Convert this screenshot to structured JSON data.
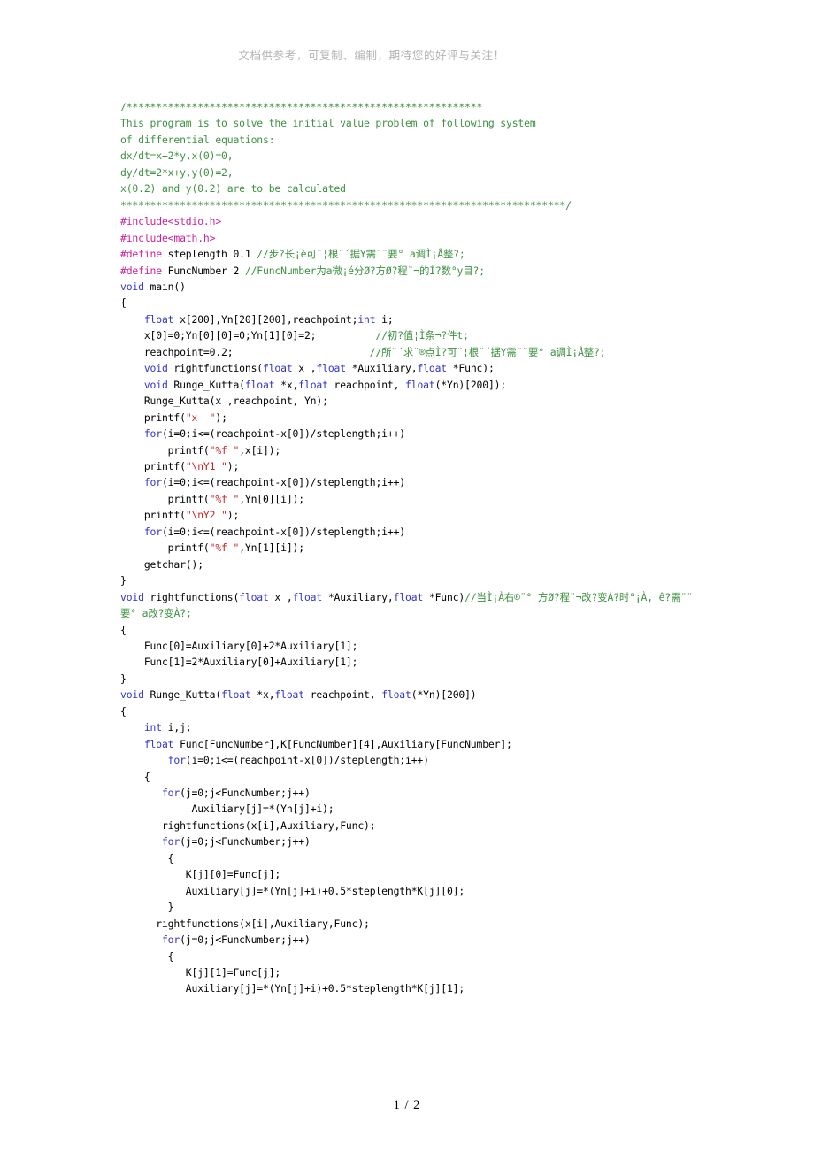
{
  "document": {
    "header_note": "文档供参考，可复制、编制，期待您的好评与关注！",
    "footer_page": "1 / 2",
    "page_current": "1",
    "page_total": "2"
  },
  "colors": {
    "comment": "#3d9140",
    "preprocessor": "#cc2299",
    "keyword": "#3333cc",
    "string": "#cc2222",
    "plain": "#000000",
    "header_note": "#b4b4b4",
    "background": "#ffffff"
  },
  "code": {
    "language": "C",
    "lines": [
      {
        "id": 1,
        "segments": [
          {
            "t": "comment",
            "v": "/************************************************************"
          }
        ]
      },
      {
        "id": 2,
        "segments": [
          {
            "t": "comment",
            "v": "This program is to solve the initial value problem of following system"
          }
        ]
      },
      {
        "id": 3,
        "segments": [
          {
            "t": "comment",
            "v": "of differential equations:"
          }
        ]
      },
      {
        "id": 4,
        "segments": [
          {
            "t": "comment",
            "v": "dx/dt=x+2*y,x(0)=0,"
          }
        ]
      },
      {
        "id": 5,
        "segments": [
          {
            "t": "comment",
            "v": "dy/dt=2*x+y,y(0)=2,"
          }
        ]
      },
      {
        "id": 6,
        "segments": [
          {
            "t": "comment",
            "v": "x(0.2) and y(0.2) are to be calculated"
          }
        ]
      },
      {
        "id": 7,
        "segments": [
          {
            "t": "comment",
            "v": "***************************************************************************/"
          }
        ]
      },
      {
        "id": 8,
        "segments": [
          {
            "t": "pre",
            "v": "#include"
          },
          {
            "t": "pre",
            "v": "<stdio.h>"
          }
        ]
      },
      {
        "id": 9,
        "segments": [
          {
            "t": "pre",
            "v": "#include"
          },
          {
            "t": "pre",
            "v": "<math.h>"
          }
        ]
      },
      {
        "id": 10,
        "segments": [
          {
            "t": "pre",
            "v": "#define"
          },
          {
            "t": "plain",
            "v": " steplength 0.1 "
          },
          {
            "t": "comment",
            "v": "//步?长¡è可¨¦根¨´据Y需¨¨要° a调Ì¡Å整?;"
          }
        ]
      },
      {
        "id": 11,
        "segments": [
          {
            "t": "pre",
            "v": "#define"
          },
          {
            "t": "plain",
            "v": " FuncNumber 2 "
          },
          {
            "t": "comment",
            "v": "//FuncNumber为a微¡é分Ø?方Ø?程¨¬的Ì?数°y目?;"
          }
        ]
      },
      {
        "id": 12,
        "segments": [
          {
            "t": "key",
            "v": "void"
          },
          {
            "t": "plain",
            "v": " main()"
          }
        ]
      },
      {
        "id": 13,
        "segments": [
          {
            "t": "plain",
            "v": "{"
          }
        ]
      },
      {
        "id": 14,
        "segments": [
          {
            "t": "plain",
            "v": "    "
          },
          {
            "t": "key",
            "v": "float"
          },
          {
            "t": "plain",
            "v": " x[200],Yn[20][200],reachpoint;"
          },
          {
            "t": "key",
            "v": "int"
          },
          {
            "t": "plain",
            "v": " i;"
          }
        ]
      },
      {
        "id": 15,
        "segments": [
          {
            "t": "plain",
            "v": "    x[0]=0;Yn[0][0]=0;Yn[1][0]=2;          "
          },
          {
            "t": "comment",
            "v": "//初?值¦Ì条¬?件t;"
          }
        ]
      },
      {
        "id": 16,
        "segments": [
          {
            "t": "plain",
            "v": "    reachpoint=0.2;                       "
          },
          {
            "t": "comment",
            "v": "//所¨´求¨®点Ì?可¨¦根¨´据Y需¨¨要° a调Ì¡Å整?;"
          }
        ]
      },
      {
        "id": 17,
        "segments": [
          {
            "t": "plain",
            "v": "    "
          },
          {
            "t": "key",
            "v": "void"
          },
          {
            "t": "plain",
            "v": " rightfunctions("
          },
          {
            "t": "key",
            "v": "float"
          },
          {
            "t": "plain",
            "v": " x ,"
          },
          {
            "t": "key",
            "v": "float"
          },
          {
            "t": "plain",
            "v": " *Auxiliary,"
          },
          {
            "t": "key",
            "v": "float"
          },
          {
            "t": "plain",
            "v": " *Func);"
          }
        ]
      },
      {
        "id": 18,
        "segments": [
          {
            "t": "plain",
            "v": "    "
          },
          {
            "t": "key",
            "v": "void"
          },
          {
            "t": "plain",
            "v": " Runge_Kutta("
          },
          {
            "t": "key",
            "v": "float"
          },
          {
            "t": "plain",
            "v": " *x,"
          },
          {
            "t": "key",
            "v": "float"
          },
          {
            "t": "plain",
            "v": " reachpoint, "
          },
          {
            "t": "key",
            "v": "float"
          },
          {
            "t": "plain",
            "v": "(*Yn)[200]);"
          }
        ]
      },
      {
        "id": 19,
        "segments": [
          {
            "t": "plain",
            "v": "    Runge_Kutta(x ,reachpoint, Yn);"
          }
        ]
      },
      {
        "id": 20,
        "segments": [
          {
            "t": "plain",
            "v": "    printf("
          },
          {
            "t": "str",
            "v": "\"x  \""
          },
          {
            "t": "plain",
            "v": ");"
          }
        ]
      },
      {
        "id": 21,
        "segments": [
          {
            "t": "plain",
            "v": "    "
          },
          {
            "t": "key",
            "v": "for"
          },
          {
            "t": "plain",
            "v": "(i=0;i<=(reachpoint-x[0])/steplength;i++)"
          }
        ]
      },
      {
        "id": 22,
        "segments": [
          {
            "t": "plain",
            "v": "        printf("
          },
          {
            "t": "str",
            "v": "\"%f \""
          },
          {
            "t": "plain",
            "v": ",x[i]);"
          }
        ]
      },
      {
        "id": 23,
        "segments": [
          {
            "t": "plain",
            "v": "    printf("
          },
          {
            "t": "str",
            "v": "\"\\nY1 \""
          },
          {
            "t": "plain",
            "v": ");"
          }
        ]
      },
      {
        "id": 24,
        "segments": [
          {
            "t": "plain",
            "v": "    "
          },
          {
            "t": "key",
            "v": "for"
          },
          {
            "t": "plain",
            "v": "(i=0;i<=(reachpoint-x[0])/steplength;i++)"
          }
        ]
      },
      {
        "id": 25,
        "segments": [
          {
            "t": "plain",
            "v": "        printf("
          },
          {
            "t": "str",
            "v": "\"%f \""
          },
          {
            "t": "plain",
            "v": ",Yn[0][i]);"
          }
        ]
      },
      {
        "id": 26,
        "segments": [
          {
            "t": "plain",
            "v": "    printf("
          },
          {
            "t": "str",
            "v": "\"\\nY2 \""
          },
          {
            "t": "plain",
            "v": ");"
          }
        ]
      },
      {
        "id": 27,
        "segments": [
          {
            "t": "plain",
            "v": "    "
          },
          {
            "t": "key",
            "v": "for"
          },
          {
            "t": "plain",
            "v": "(i=0;i<=(reachpoint-x[0])/steplength;i++)"
          }
        ]
      },
      {
        "id": 28,
        "segments": [
          {
            "t": "plain",
            "v": "        printf("
          },
          {
            "t": "str",
            "v": "\"%f \""
          },
          {
            "t": "plain",
            "v": ",Yn[1][i]);"
          }
        ]
      },
      {
        "id": 29,
        "segments": [
          {
            "t": "plain",
            "v": "    getchar();"
          }
        ]
      },
      {
        "id": 30,
        "segments": [
          {
            "t": "plain",
            "v": "}"
          }
        ]
      },
      {
        "id": 31,
        "segments": [
          {
            "t": "key",
            "v": "void"
          },
          {
            "t": "plain",
            "v": " rightfunctions("
          },
          {
            "t": "key",
            "v": "float"
          },
          {
            "t": "plain",
            "v": " x ,"
          },
          {
            "t": "key",
            "v": "float"
          },
          {
            "t": "plain",
            "v": " *Auxiliary,"
          },
          {
            "t": "key",
            "v": "float"
          },
          {
            "t": "plain",
            "v": " *Func)"
          },
          {
            "t": "comment",
            "v": "//当Ì¡À右®¨° 方Ø?程¨¬改?变À?时°¡À, ê?需¨¨要° a改?变À?;"
          }
        ]
      },
      {
        "id": 32,
        "segments": [
          {
            "t": "plain",
            "v": "{"
          }
        ]
      },
      {
        "id": 33,
        "segments": [
          {
            "t": "plain",
            "v": "    Func[0]=Auxiliary[0]+2*Auxiliary[1];"
          }
        ]
      },
      {
        "id": 34,
        "segments": [
          {
            "t": "plain",
            "v": "    Func[1]=2*Auxiliary[0]+Auxiliary[1];"
          }
        ]
      },
      {
        "id": 35,
        "segments": [
          {
            "t": "plain",
            "v": "}"
          }
        ]
      },
      {
        "id": 36,
        "segments": [
          {
            "t": "key",
            "v": "void"
          },
          {
            "t": "plain",
            "v": " Runge_Kutta("
          },
          {
            "t": "key",
            "v": "float"
          },
          {
            "t": "plain",
            "v": " *x,"
          },
          {
            "t": "key",
            "v": "float"
          },
          {
            "t": "plain",
            "v": " reachpoint, "
          },
          {
            "t": "key",
            "v": "float"
          },
          {
            "t": "plain",
            "v": "(*Yn)[200])"
          }
        ]
      },
      {
        "id": 37,
        "segments": [
          {
            "t": "plain",
            "v": "{"
          }
        ]
      },
      {
        "id": 38,
        "segments": [
          {
            "t": "plain",
            "v": "    "
          },
          {
            "t": "key",
            "v": "int"
          },
          {
            "t": "plain",
            "v": " i,j;"
          }
        ]
      },
      {
        "id": 39,
        "segments": [
          {
            "t": "plain",
            "v": "    "
          },
          {
            "t": "key",
            "v": "float"
          },
          {
            "t": "plain",
            "v": " Func[FuncNumber],K[FuncNumber][4],Auxiliary[FuncNumber];"
          }
        ]
      },
      {
        "id": 40,
        "segments": [
          {
            "t": "plain",
            "v": "        "
          },
          {
            "t": "key",
            "v": "for"
          },
          {
            "t": "plain",
            "v": "(i=0;i<=(reachpoint-x[0])/steplength;i++)"
          }
        ]
      },
      {
        "id": 41,
        "segments": [
          {
            "t": "plain",
            "v": "    {"
          }
        ]
      },
      {
        "id": 42,
        "segments": [
          {
            "t": "plain",
            "v": "       "
          },
          {
            "t": "key",
            "v": "for"
          },
          {
            "t": "plain",
            "v": "(j=0;j<FuncNumber;j++)"
          }
        ]
      },
      {
        "id": 43,
        "segments": [
          {
            "t": "plain",
            "v": "            Auxiliary[j]=*(Yn[j]+i);"
          }
        ]
      },
      {
        "id": 44,
        "segments": [
          {
            "t": "plain",
            "v": "       rightfunctions(x[i],Auxiliary,Func);"
          }
        ]
      },
      {
        "id": 45,
        "segments": [
          {
            "t": "plain",
            "v": "       "
          },
          {
            "t": "key",
            "v": "for"
          },
          {
            "t": "plain",
            "v": "(j=0;j<FuncNumber;j++)"
          }
        ]
      },
      {
        "id": 46,
        "segments": [
          {
            "t": "plain",
            "v": "        {"
          }
        ]
      },
      {
        "id": 47,
        "segments": [
          {
            "t": "plain",
            "v": "           K[j][0]=Func[j];"
          }
        ]
      },
      {
        "id": 48,
        "segments": [
          {
            "t": "plain",
            "v": "           Auxiliary[j]=*(Yn[j]+i)+0.5*steplength*K[j][0];"
          }
        ]
      },
      {
        "id": 49,
        "segments": [
          {
            "t": "plain",
            "v": "        }"
          }
        ]
      },
      {
        "id": 50,
        "segments": [
          {
            "t": "plain",
            "v": "      rightfunctions(x[i],Auxiliary,Func);"
          }
        ]
      },
      {
        "id": 51,
        "segments": [
          {
            "t": "plain",
            "v": "       "
          },
          {
            "t": "key",
            "v": "for"
          },
          {
            "t": "plain",
            "v": "(j=0;j<FuncNumber;j++)"
          }
        ]
      },
      {
        "id": 52,
        "segments": [
          {
            "t": "plain",
            "v": "        {"
          }
        ]
      },
      {
        "id": 53,
        "segments": [
          {
            "t": "plain",
            "v": "           K[j][1]=Func[j];"
          }
        ]
      },
      {
        "id": 54,
        "segments": [
          {
            "t": "plain",
            "v": "           Auxiliary[j]=*(Yn[j]+i)+0.5*steplength*K[j][1];"
          }
        ]
      }
    ]
  }
}
